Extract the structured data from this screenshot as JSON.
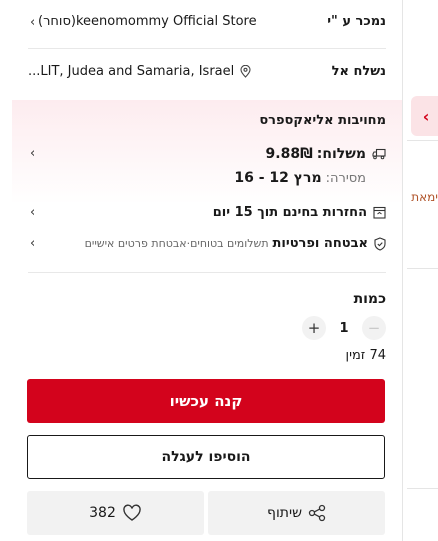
{
  "seller": {
    "label": "נמכר ע \"י",
    "value": "keenomommy Official Store(סוחר)"
  },
  "ship_to": {
    "label": "נשלח אל",
    "value": "...LIT, Judea and Samaria, Israel"
  },
  "commitment": {
    "title": "מחויבות אליאקספרס"
  },
  "shipping": {
    "label": "משלוח:",
    "price": "9.88₪",
    "delivery_label": "מסירה:",
    "delivery_dates": "מרץ 12 - 16"
  },
  "returns": {
    "text": "החזרות בחינם תוך 15 יום"
  },
  "security": {
    "title": "אבטחה ופרטיות",
    "detail": "תשלומים בטוחים·אבטחת פרטים אישיים"
  },
  "quantity": {
    "label": "כמות",
    "value": "1",
    "available": "74 זמין"
  },
  "actions": {
    "buy_now": "קנה עכשיו",
    "add_to_cart": "הוסיפו לעגלה",
    "share": "שיתוף",
    "wishlist_count": "382"
  },
  "side": {
    "partial_text": "ימאת"
  }
}
